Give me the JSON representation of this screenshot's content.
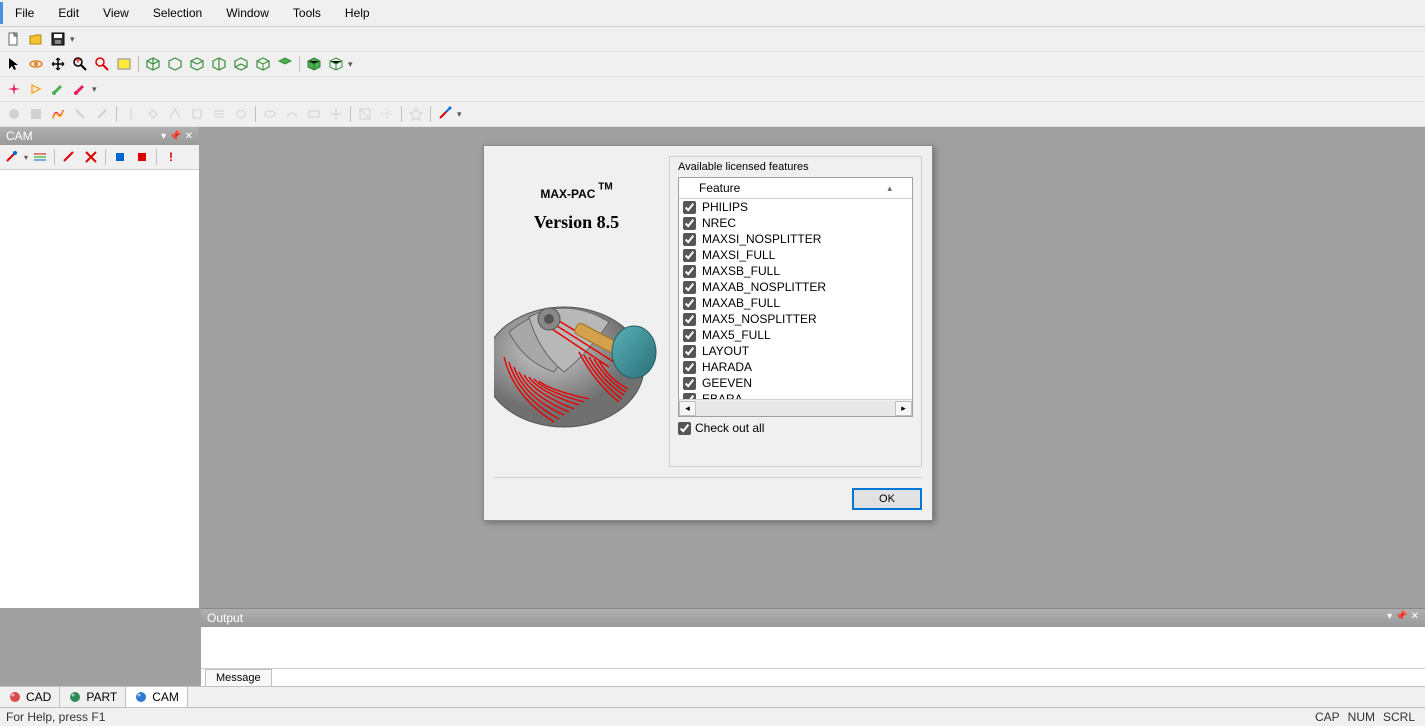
{
  "menu": [
    "File",
    "Edit",
    "View",
    "Selection",
    "Window",
    "Tools",
    "Help"
  ],
  "cam_panel": {
    "title": "CAM"
  },
  "dialog": {
    "brand": "MAX-PAC",
    "tm": "TM",
    "version_label": "Version 8.5",
    "available_label": "Available licensed features",
    "feature_header": "Feature",
    "features": [
      "PHILIPS",
      "NREC",
      "MAXSI_NOSPLITTER",
      "MAXSI_FULL",
      "MAXSB_FULL",
      "MAXAB_NOSPLITTER",
      "MAXAB_FULL",
      "MAX5_NOSPLITTER",
      "MAX5_FULL",
      "LAYOUT",
      "HARADA",
      "GEEVEN",
      "EBARA"
    ],
    "checkout_label": "Check out all",
    "ok_label": "OK"
  },
  "output": {
    "title": "Output",
    "tab": "Message"
  },
  "bottom_tabs": [
    {
      "label": "CAD",
      "color": "#d94a4a"
    },
    {
      "label": "PART",
      "color": "#2e8b57"
    },
    {
      "label": "CAM",
      "color": "#2e7bd1",
      "active": true
    }
  ],
  "status": {
    "help": "For Help, press F1",
    "indicators": [
      "CAP",
      "NUM",
      "SCRL"
    ]
  }
}
